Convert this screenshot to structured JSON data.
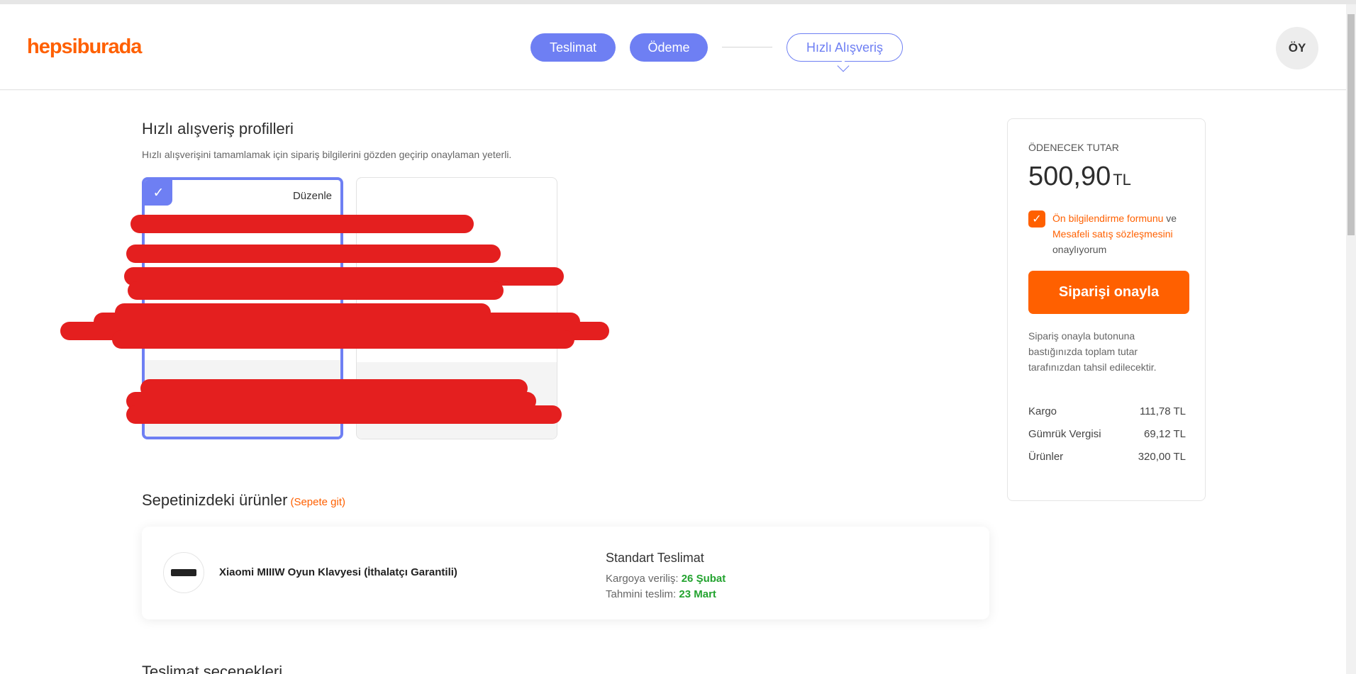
{
  "header": {
    "logo": "hepsiburada",
    "steps": [
      "Teslimat",
      "Ödeme",
      "Hızlı Alışveriş"
    ],
    "avatar": "ÖY"
  },
  "profiles": {
    "title": "Hızlı alışveriş profilleri",
    "subtitle": "Hızlı alışverişini tamamlamak için sipariş bilgilerini gözden geçirip onaylaman yeterli.",
    "edit_label": "Düzenle",
    "check_icon": "✓"
  },
  "basket": {
    "title": "Sepetinizdeki ürünler",
    "go_link": "(Sepete git)",
    "product_name": "Xiaomi MIIIW Oyun Klavyesi (İthalatçı Garantili)",
    "delivery_title": "Standart Teslimat",
    "ship_label": "Kargoya veriliş:",
    "ship_date": "26 Şubat",
    "est_label": "Tahmini teslim:",
    "est_date": "23 Mart"
  },
  "delivery_options_title": "Teslimat seçenekleri",
  "summary": {
    "label": "ÖDENECEK TUTAR",
    "amount": "500,90",
    "currency": "TL",
    "agree_link1": "Ön bilgilendirme formunu",
    "agree_ve": "ve",
    "agree_link2": "Mesafeli satış sözleşmesini",
    "agree_tail": "onaylıyorum",
    "confirm_label": "Siparişi onayla",
    "note": "Sipariş onayla butonuna bastığınızda toplam tutar tarafınızdan tahsil edilecektir.",
    "lines": [
      {
        "label": "Kargo",
        "value": "111,78 TL"
      },
      {
        "label": "Gümrük Vergisi",
        "value": "69,12 TL"
      },
      {
        "label": "Ürünler",
        "value": "320,00 TL"
      }
    ]
  },
  "colors": {
    "brand": "#ff6000",
    "step_accent": "#6e7ff3",
    "redaction": "#e41f1f",
    "date_green": "#23a32f"
  }
}
